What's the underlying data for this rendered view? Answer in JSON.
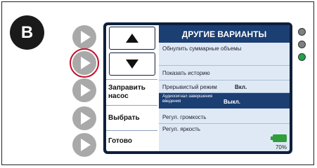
{
  "badge": "B",
  "title": "ДРУГИЕ ВАРИАНТЫ",
  "menu": [
    {
      "label": "Обнулить суммарные объемы",
      "value": ""
    },
    {
      "label": "Показать историю",
      "value": ""
    },
    {
      "label": "Прерывистый режим",
      "value": "Вкл."
    },
    {
      "label": "Аудиосигнал завершения введения",
      "value": "Выкл."
    },
    {
      "label": "Регул. громкость",
      "value": ""
    },
    {
      "label": "Регул. яркость",
      "value": ""
    }
  ],
  "side_buttons": {
    "prime": "Заправить насос",
    "select": "Выбрать",
    "done": "Готово"
  },
  "battery_pct": "70%",
  "colors": {
    "title_bar": "#1b3e73",
    "panel": "#dfe9f5",
    "led_off": "#808080",
    "led_on": "#1fa34a",
    "selection_ring": "#c0112b"
  }
}
